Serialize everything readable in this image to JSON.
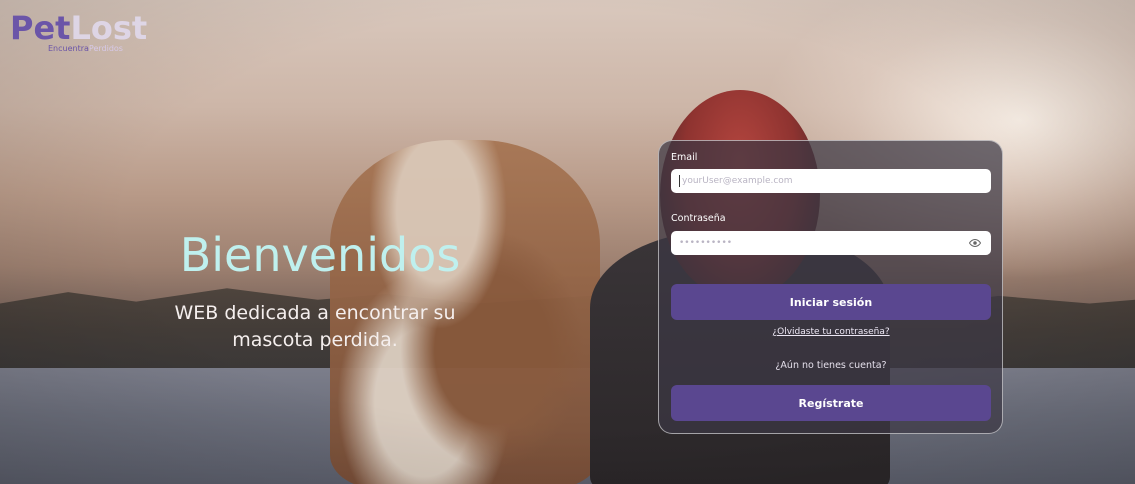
{
  "logo": {
    "word_pet": "Pet",
    "word_lost": "Lost",
    "tagline_a": "Encuentra",
    "tagline_b": "Perdidos"
  },
  "hero": {
    "title": "Bienvenidos",
    "subtitle_line1": "WEB dedicada a encontrar su",
    "subtitle_line2": "mascota perdida."
  },
  "login": {
    "email_label": "Email",
    "email_placeholder": "yourUser@example.com",
    "password_label": "Contraseña",
    "password_value": "••••••••••",
    "submit_label": "Iniciar sesión",
    "forgot_link": "¿Olvidaste tu contraseña?",
    "no_account_text": "¿Aún no tienes cuenta?",
    "register_label": "Regístrate"
  },
  "colors": {
    "brand_purple": "#5a4790",
    "title_mint": "#bff0ee"
  }
}
